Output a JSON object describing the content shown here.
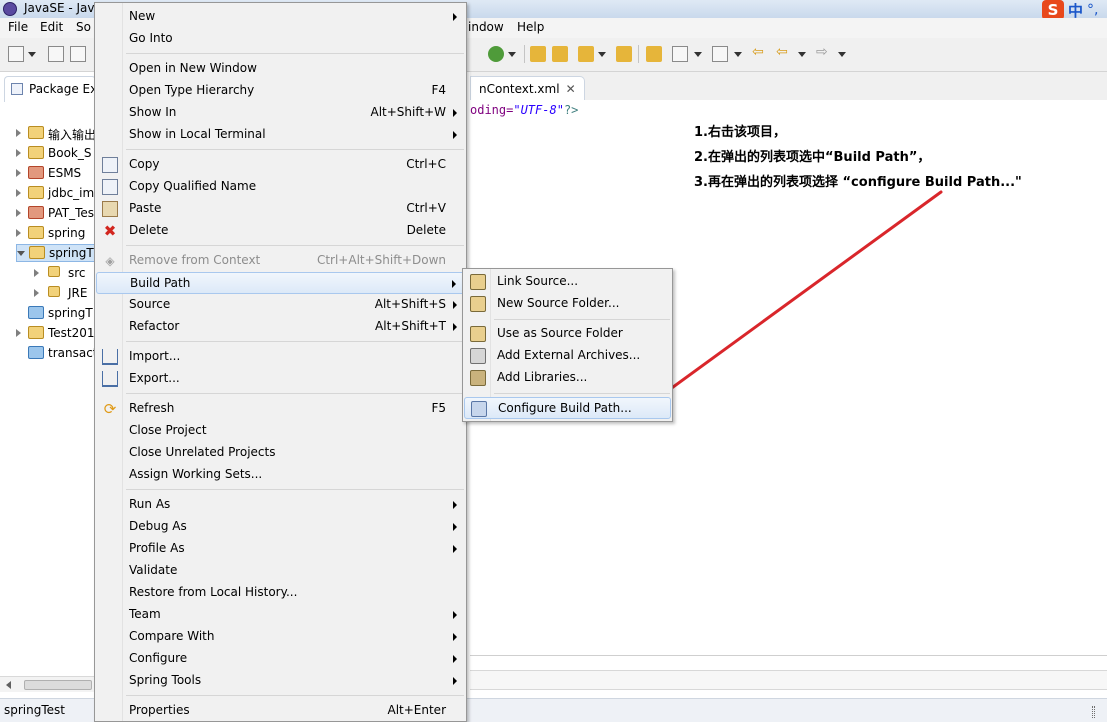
{
  "window": {
    "title": "JavaSE - Jav"
  },
  "ime": {
    "logo": "S",
    "mode": "中",
    "punct": "°,"
  },
  "menubar": {
    "file": "File",
    "edit": "Edit",
    "source": "So",
    "window": "indow",
    "help": "Help"
  },
  "explorer": {
    "tab_label": "Package Ex",
    "items": [
      {
        "name": "输入输出"
      },
      {
        "name": "Book_S"
      },
      {
        "name": "ESMS"
      },
      {
        "name": "jdbc_im"
      },
      {
        "name": "PAT_Tes"
      },
      {
        "name": "spring"
      },
      {
        "name": "springT"
      },
      {
        "name": "src"
      },
      {
        "name": "JRE"
      },
      {
        "name": "springT"
      },
      {
        "name": "Test201"
      },
      {
        "name": "transact"
      }
    ]
  },
  "status": {
    "text": "springTest"
  },
  "editor": {
    "tab_label": "nContext.xml",
    "tab_close": "✕",
    "line_attr": "oding=",
    "line_value": "\"UTF-8\"",
    "line_end": "?>"
  },
  "annotation": {
    "line1": "1.右击该项目，",
    "line2": "2.在弹出的列表项选中“Build Path”，",
    "line3": "3.再在弹出的列表项选择 “configure Build Path...\"",
    "arrow_color": "#d9262b"
  },
  "context_menu": {
    "new": "New",
    "go_into": "Go Into",
    "open_new_window": "Open in New Window",
    "open_type_hierarchy": "Open Type Hierarchy",
    "open_type_hierarchy_sc": "F4",
    "show_in": "Show In",
    "show_in_sc": "Alt+Shift+W",
    "show_local_terminal": "Show in Local Terminal",
    "copy": "Copy",
    "copy_sc": "Ctrl+C",
    "copy_qualified": "Copy Qualified Name",
    "paste": "Paste",
    "paste_sc": "Ctrl+V",
    "delete": "Delete",
    "delete_sc": "Delete",
    "remove_context": "Remove from Context",
    "remove_context_sc": "Ctrl+Alt+Shift+Down",
    "build_path": "Build Path",
    "source": "Source",
    "source_sc": "Alt+Shift+S",
    "refactor": "Refactor",
    "refactor_sc": "Alt+Shift+T",
    "import": "Import...",
    "export": "Export...",
    "refresh": "Refresh",
    "refresh_sc": "F5",
    "close_project": "Close Project",
    "close_unrelated": "Close Unrelated Projects",
    "assign_working_sets": "Assign Working Sets...",
    "run_as": "Run As",
    "debug_as": "Debug As",
    "profile_as": "Profile As",
    "validate": "Validate",
    "restore_history": "Restore from Local History...",
    "team": "Team",
    "compare_with": "Compare With",
    "configure": "Configure",
    "spring_tools": "Spring Tools",
    "properties": "Properties",
    "properties_sc": "Alt+Enter"
  },
  "build_path_menu": {
    "link_source": "Link Source...",
    "new_source_folder": "New Source Folder...",
    "use_as_source": "Use as Source Folder",
    "add_external_archives": "Add External Archives...",
    "add_libraries": "Add Libraries...",
    "configure_build_path": "Configure Build Path..."
  }
}
